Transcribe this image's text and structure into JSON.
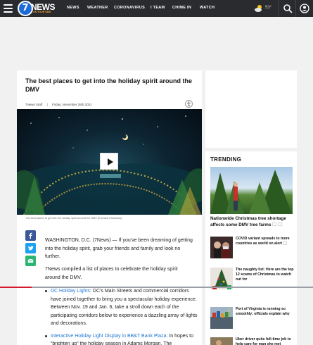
{
  "nav": {
    "logo_number": "7",
    "logo_text": "NEWS",
    "logo_tagline": "ON YOUR SIDE",
    "items": [
      {
        "label": "NEWS"
      },
      {
        "label": "WEATHER"
      },
      {
        "label": "CORONAVIRUS"
      },
      {
        "label": "I TEAM"
      },
      {
        "label": "CHIME IN"
      },
      {
        "label": "WATCH"
      }
    ],
    "weather_temp": "53°",
    "weather_icon": "partly-cloudy-icon",
    "search_icon": "search-icon",
    "account_icon": "account-icon",
    "colors": {
      "bar": "#2a2b2e",
      "logo_blue": "#1c6bd6",
      "accent": "#d3192a"
    }
  },
  "article": {
    "headline": "The best places to get into the holiday spirit around the DMV",
    "byline_author": "7News Staff",
    "byline_sep": "|",
    "byline_date": "Friday, November 26th 2021",
    "caption": "The best places to get into the holiday spirit around the DMV (Enchant Christmas)",
    "paragraph1": "WASHINGTON, D.C. (7News) — If you've been dreaming of getting into the holiday spirit, grab your friends and family and look no further.",
    "paragraph2": "7News compiled a list of places to celebrate the holiday spirit around the DMV.",
    "bullets": [
      {
        "link": "DC Holiday Lights",
        "text": ": DC's Main Streets and commercial corridors have joined together to bring you a spectacular holiday experience. Between Nov. 19 and Jan. 6, take a stroll down each of the participating corridors below to experience a dazzling array of lights and decorations."
      },
      {
        "link": "Interactive Holiday Light Display in BB&T Bank Plaza",
        "text": ": In hopes to “brighten up” the holiday season in Adams Morgan, The"
      }
    ],
    "share_colors": {
      "facebook": "#3b5998",
      "twitter": "#1da1f2",
      "email": "#2bb673"
    }
  },
  "trending": {
    "title": "TRENDING",
    "hero_title": "Nationwide Christmas tree shortage affects some DMV tree farms",
    "items": [
      {
        "title": "COVID variant spreads to more countries as world on alert"
      },
      {
        "title": "The naughty list: Here are the top 12 scams of Christmas to watch out for"
      },
      {
        "title": "Port of Virginia is running so smoothly; officials explain why"
      },
      {
        "title": "Uber driver quits full-time job to help care for man she met"
      }
    ]
  },
  "scroll_progress": 0.1
}
